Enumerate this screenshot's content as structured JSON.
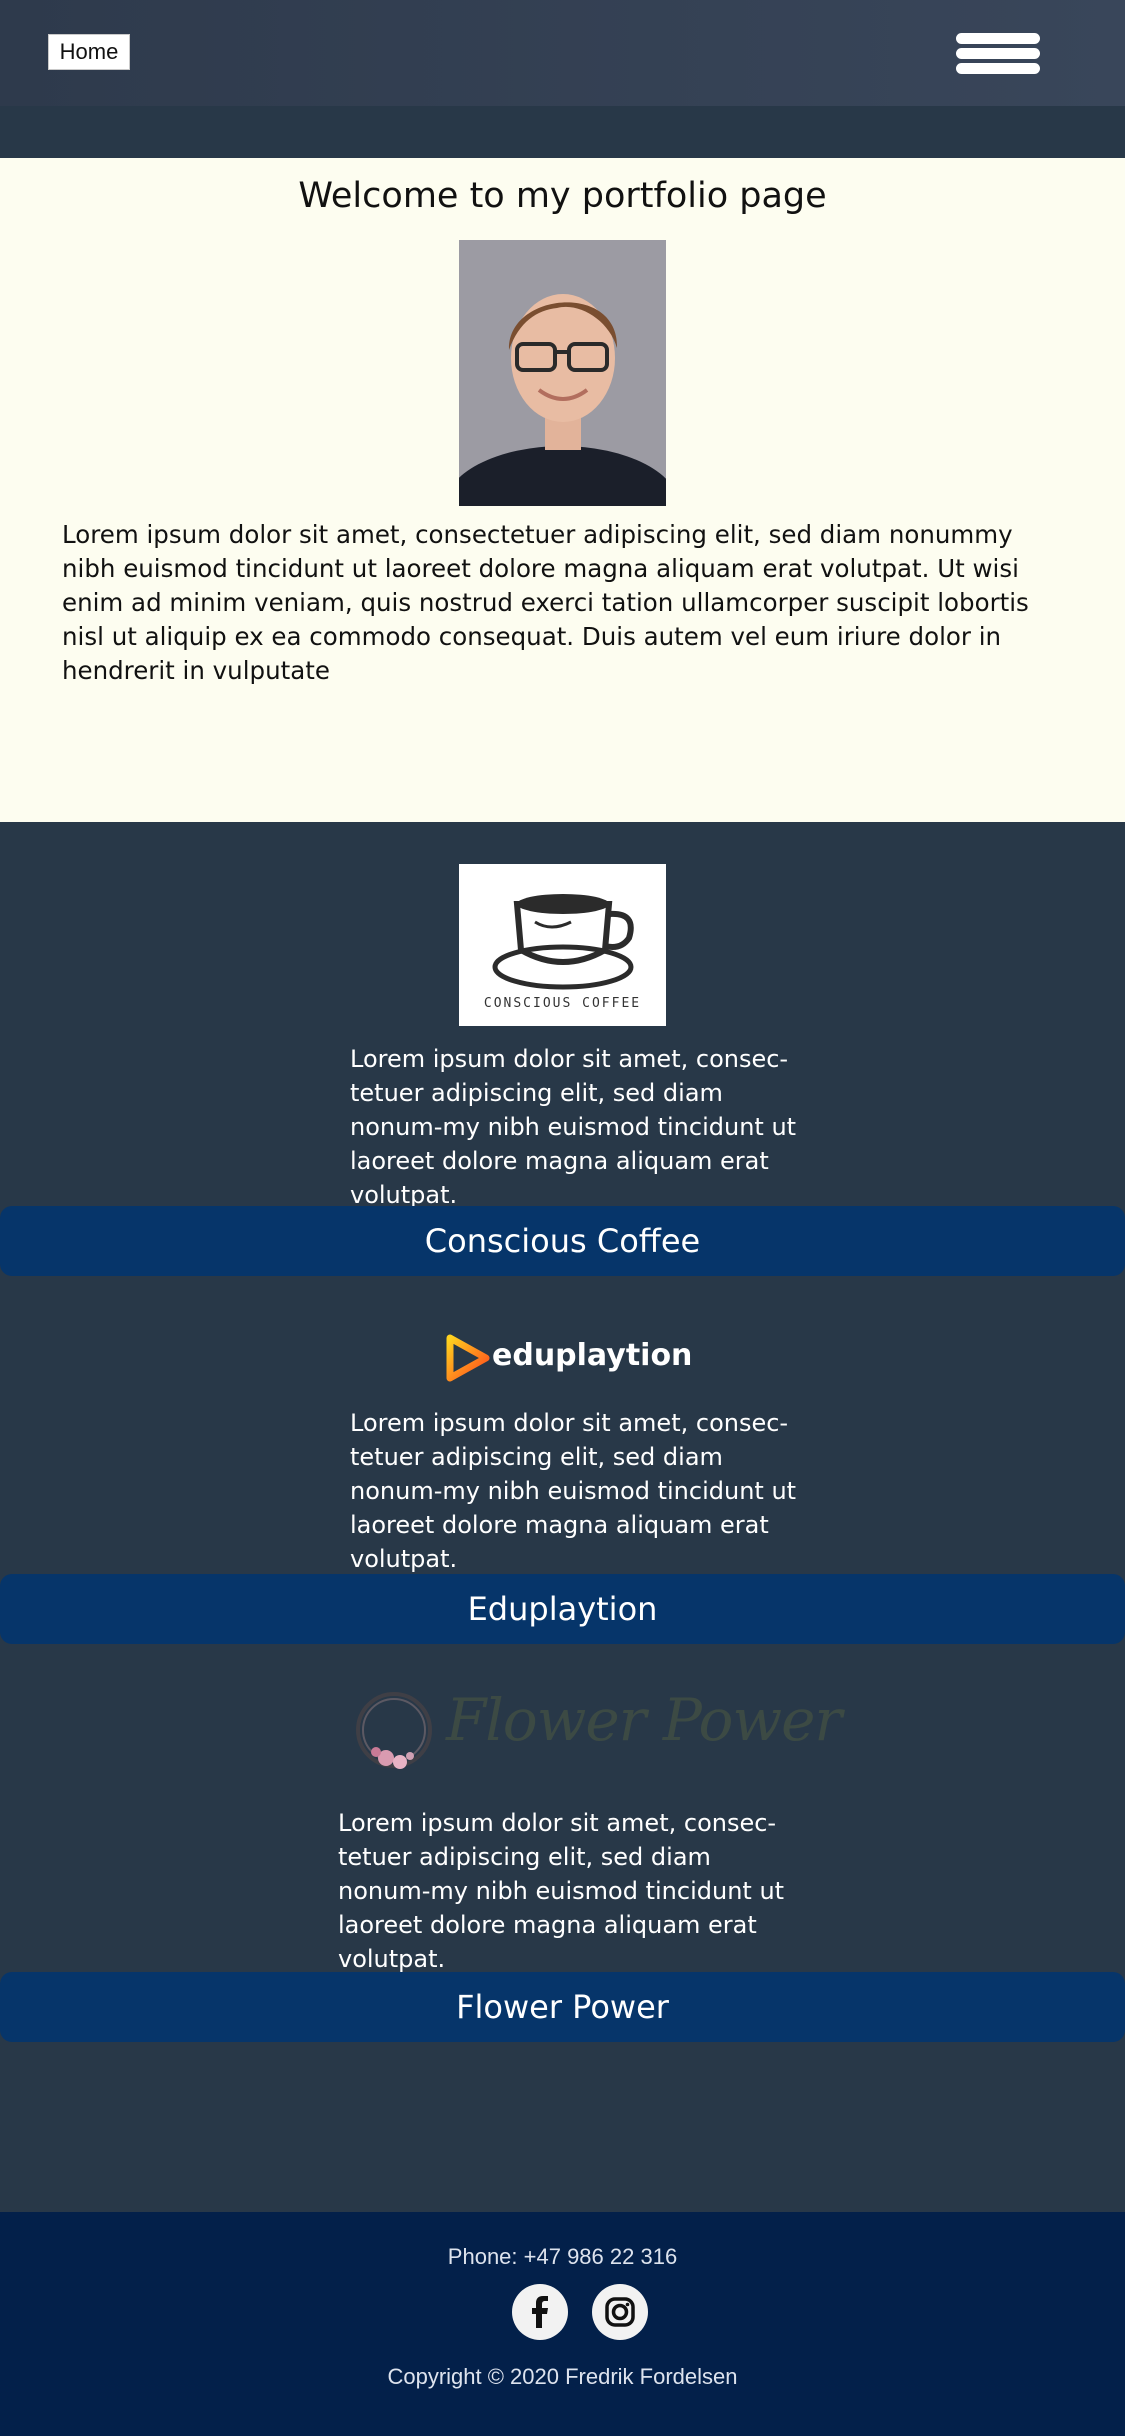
{
  "nav": {
    "home_label": "Home",
    "menu_icon": "hamburger-menu-icon"
  },
  "intro": {
    "title": "Welcome to my portfolio page",
    "photo": "portrait-photo",
    "text": "Lorem ipsum dolor sit amet, consectetuer adipiscing elit, sed diam nonummy nibh euismod tincidunt ut laoreet dolore magna aliquam erat volutpat. Ut wisi enim ad minim veniam, quis nostrud exerci tation ullamcorper suscipit lobortis nisl ut aliquip ex ea commodo consequat. Duis autem vel eum iriure dolor in hendrerit in vulputate"
  },
  "projects": [
    {
      "logo_text": "CONSCIOUS COFFEE",
      "text": "Lorem ipsum dolor sit amet, consec-tetuer adipiscing elit, sed diam nonum-my nibh euismod tincidunt ut laoreet dolore magna aliquam erat volutpat.",
      "title": "Conscious Coffee"
    },
    {
      "logo_text": "eduplaytion",
      "text": "Lorem ipsum dolor sit amet, consec-tetuer adipiscing elit, sed diam nonum-my nibh euismod tincidunt ut laoreet dolore magna aliquam erat volutpat.",
      "title": "Eduplaytion"
    },
    {
      "logo_text": "Flower Power",
      "text": "Lorem ipsum dolor sit amet, consec-tetuer adipiscing elit, sed diam nonum-my nibh euismod tincidunt ut laoreet dolore magna aliquam erat volutpat.",
      "title": "Flower Power"
    }
  ],
  "footer": {
    "phone": "Phone: +47 986 22 316",
    "social_icons": [
      "facebook-icon",
      "instagram-icon"
    ],
    "copyright": "Copyright © 2020 Fredrik Fordelsen"
  },
  "colors": {
    "header": "#2e3a4c",
    "intro_bg": "#fdfdf0",
    "projects_bg": "#283848",
    "project_bar": "#06356a",
    "footer_bg": "#03204a"
  }
}
